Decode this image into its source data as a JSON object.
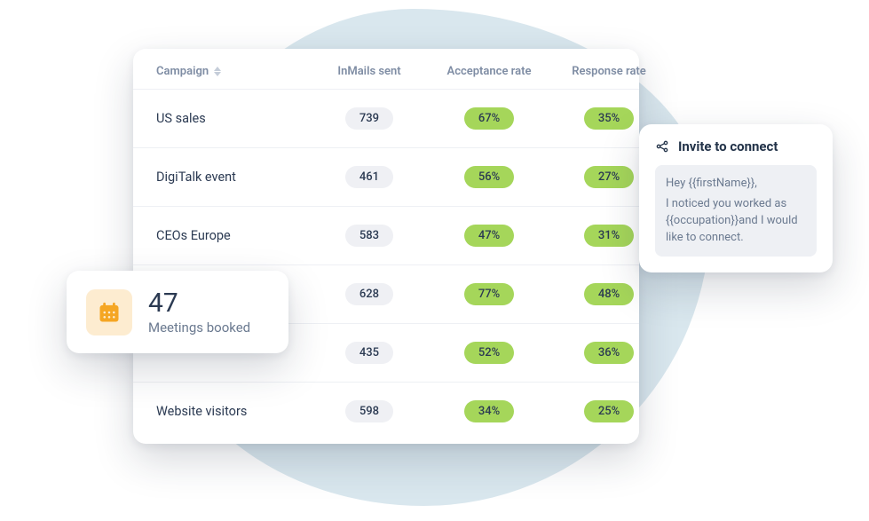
{
  "table": {
    "headers": {
      "campaign": "Campaign",
      "inmails": "InMails sent",
      "acceptance": "Acceptance rate",
      "response": "Response rate"
    },
    "rows": [
      {
        "name": "US sales",
        "inmails": "739",
        "acceptance": "67%",
        "response": "35%"
      },
      {
        "name": "DigiTalk event",
        "inmails": "461",
        "acceptance": "56%",
        "response": "27%"
      },
      {
        "name": "CEOs Europe",
        "inmails": "583",
        "acceptance": "47%",
        "response": "31%"
      },
      {
        "name": "",
        "inmails": "628",
        "acceptance": "77%",
        "response": "48%"
      },
      {
        "name": "",
        "inmails": "435",
        "acceptance": "52%",
        "response": "36%"
      },
      {
        "name": "Website visitors",
        "inmails": "598",
        "acceptance": "34%",
        "response": "25%"
      }
    ]
  },
  "meetings": {
    "count": "47",
    "label": "Meetings booked"
  },
  "invite": {
    "title": "Invite to connect",
    "line1": "Hey {{firstName}},",
    "line2": "I noticed you worked as {{occupation}}and I would like to connect."
  },
  "chart_data": {
    "type": "table",
    "columns": [
      "Campaign",
      "InMails sent",
      "Acceptance rate",
      "Response rate"
    ],
    "rows": [
      [
        "US sales",
        739,
        "67%",
        "35%"
      ],
      [
        "DigiTalk event",
        461,
        "56%",
        "27%"
      ],
      [
        "CEOs Europe",
        583,
        "47%",
        "31%"
      ],
      [
        "",
        628,
        "77%",
        "48%"
      ],
      [
        "",
        435,
        "52%",
        "36%"
      ],
      [
        "Website visitors",
        598,
        "34%",
        "25%"
      ]
    ]
  }
}
